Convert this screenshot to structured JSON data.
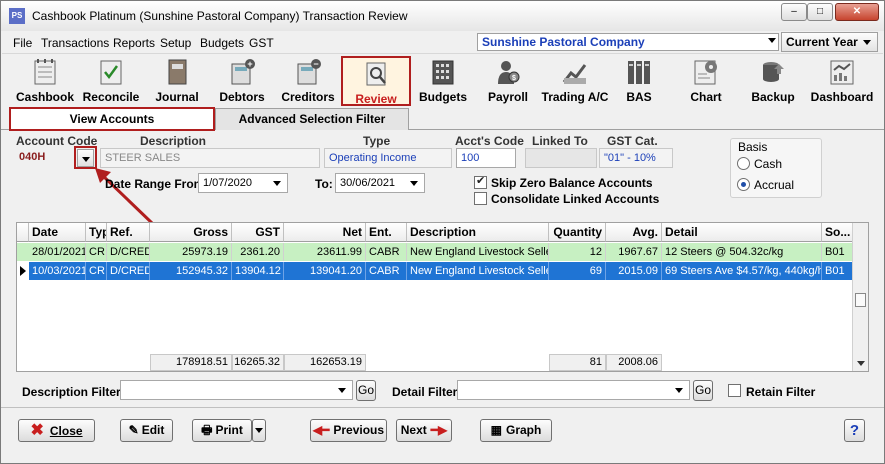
{
  "window": {
    "icon_text": "PS",
    "title": "Cashbook Platinum (Sunshine Pastoral Company)  Transaction Review",
    "minimize": "–",
    "maximize": "□",
    "close": "✕"
  },
  "menu": [
    "File",
    "Transactions",
    "Reports",
    "Setup",
    "Budgets",
    "GST"
  ],
  "company_selector": "Sunshine Pastoral Company",
  "year_selector": "Current Year",
  "toolbar": [
    {
      "label": "Cashbook",
      "icon": "cashbook-icon"
    },
    {
      "label": "Reconcile",
      "icon": "reconcile-icon"
    },
    {
      "label": "Journal",
      "icon": "journal-icon"
    },
    {
      "label": "Debtors",
      "icon": "debtors-icon"
    },
    {
      "label": "Creditors",
      "icon": "creditors-icon"
    },
    {
      "label": "Review",
      "icon": "review-icon",
      "active": true
    },
    {
      "label": "Budgets",
      "icon": "budgets-icon"
    },
    {
      "label": "Payroll",
      "icon": "payroll-icon"
    },
    {
      "label": "Trading A/C",
      "icon": "trading-icon"
    },
    {
      "label": "BAS",
      "icon": "bas-icon"
    },
    {
      "label": "Chart",
      "icon": "chart-icon"
    },
    {
      "label": "Backup",
      "icon": "backup-icon"
    },
    {
      "label": "Dashboard",
      "icon": "dashboard-icon"
    }
  ],
  "tabs": {
    "view_accounts": "View Accounts",
    "advanced_filter": "Advanced Selection Filter"
  },
  "account": {
    "code_label": "Account Code",
    "code": "040H",
    "description_label": "Description",
    "description": "STEER SALES",
    "type_label": "Type",
    "type": "Operating Income",
    "acct_code_label": "Acct's Code",
    "acct_code": "100",
    "linked_to_label": "Linked To",
    "linked_to": "",
    "gst_cat_label": "GST Cat.",
    "gst_cat": "\"01\" - 10%"
  },
  "date_range": {
    "from_label": "Date Range From:",
    "from": "1/07/2020",
    "to_label": "To:",
    "to": "30/06/2021"
  },
  "options": {
    "skip_zero": {
      "label": "Skip Zero Balance Accounts",
      "checked": true
    },
    "consolidate": {
      "label": "Consolidate Linked Accounts",
      "checked": false
    }
  },
  "basis": {
    "label": "Basis",
    "cash": "Cash",
    "accrual": "Accrual",
    "selected": "Accrual"
  },
  "table": {
    "columns": [
      "Date",
      "Typ",
      "Ref.",
      "Gross",
      "GST",
      "Net",
      "Ent.",
      "Description",
      "Quantity",
      "Avg.",
      "Detail",
      "So..."
    ],
    "rows": [
      [
        "28/01/2021",
        "CR",
        "D/CRED",
        "25973.19",
        "2361.20",
        "23611.99",
        "CABR",
        "New England Livestock Selle",
        "12",
        "1967.67",
        "12 Steers @ 504.32c/kg",
        "B01"
      ],
      [
        "10/03/2021",
        "CR",
        "D/CRED",
        "152945.32",
        "13904.12",
        "139041.20",
        "CABR",
        "New England Livestock Selle",
        "69",
        "2015.09",
        "69 Steers Ave $4.57/kg, 440kg/h",
        "B01"
      ]
    ],
    "totals": {
      "gross": "178918.51",
      "gst": "16265.32",
      "net": "162653.19",
      "quantity": "81",
      "avg": "2008.06"
    }
  },
  "filters": {
    "description_label": "Description Filter",
    "description_value": "",
    "detail_label": "Detail Filter",
    "detail_value": "",
    "go": "Go",
    "retain_label": "Retain Filter"
  },
  "buttons": {
    "close": "Close",
    "edit": "Edit",
    "print": "Print",
    "previous": "Previous",
    "next": "Next",
    "graph": "Graph",
    "help": "?"
  },
  "colors": {
    "accent_blue": "#1b3fb8",
    "highlight_red": "#b01e1e",
    "row_green": "#c7f0c2",
    "row_selected": "#1f74d4"
  }
}
